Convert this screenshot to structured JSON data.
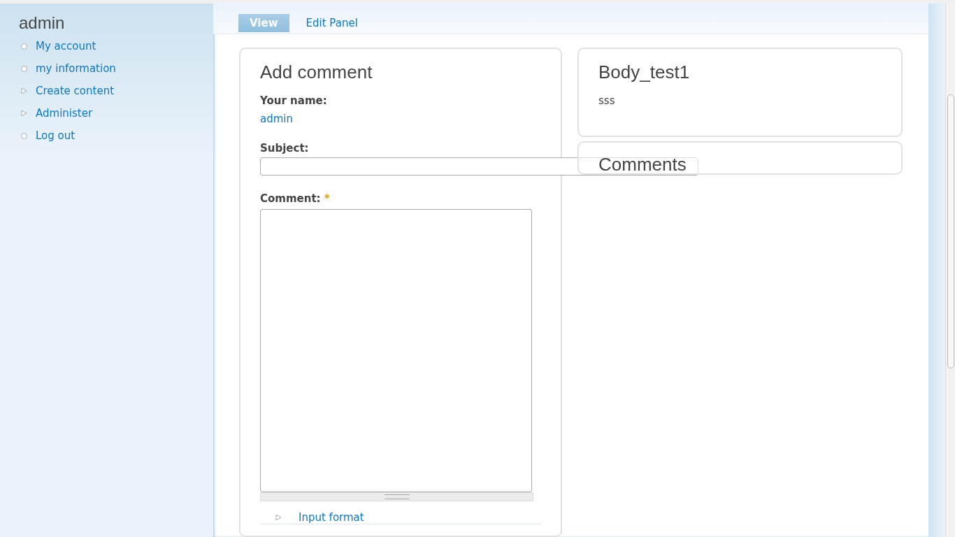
{
  "sidebar": {
    "title": "admin",
    "items": [
      {
        "label": "My account",
        "kind": "leaf"
      },
      {
        "label": "my information",
        "kind": "leaf"
      },
      {
        "label": "Create content",
        "kind": "collapsed"
      },
      {
        "label": "Administer",
        "kind": "collapsed"
      },
      {
        "label": "Log out",
        "kind": "leaf"
      }
    ]
  },
  "tabs": [
    {
      "label": "View",
      "selected": true
    },
    {
      "label": "Edit Panel",
      "selected": false
    }
  ],
  "add_comment": {
    "title": "Add comment",
    "name_label": "Your name:",
    "name_value": "admin",
    "subject_label": "Subject:",
    "comment_label": "Comment:",
    "required_mark": "*",
    "input_format": "Input format"
  },
  "node": {
    "title": "Body_test1",
    "body": "sss"
  },
  "comments": {
    "title": "Comments"
  }
}
